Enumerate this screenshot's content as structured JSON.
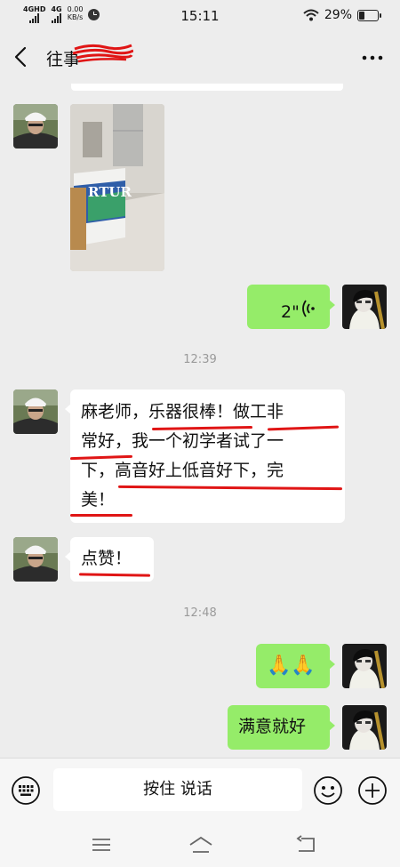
{
  "status_bar": {
    "net1": "4GHD",
    "net2": "4G",
    "speed": "0.00",
    "speed_unit": "KB/s",
    "time": "15:11",
    "battery": "29%",
    "battery_level": 0.29
  },
  "header": {
    "title": "往事",
    "back_icon": "chevron-left-icon",
    "more_icon": "more-dots-icon"
  },
  "messages": {
    "voice_duration": "2\"",
    "timestamp_1": "12:39",
    "msg_1": "麻老师，乐器很棒！做工非\n常好，我一个初学者试了一\n下，高音好上低音好下，完\n美！",
    "msg_2": "点赞！",
    "timestamp_2": "12:48",
    "msg_3": "🙏🙏",
    "msg_4": "满意就好",
    "photo_box_text": "RTUR"
  },
  "input_bar": {
    "voice_label": "按住 说话",
    "keyboard_icon": "keyboard-icon",
    "emoji_icon": "emoji-icon",
    "plus_icon": "plus-icon"
  },
  "nav_bar": {
    "menu_icon": "menu-icon",
    "home_icon": "home-icon",
    "back_icon": "back-icon"
  },
  "colors": {
    "background": "#ededed",
    "outgoing_bubble": "#95ec69",
    "incoming_bubble": "#ffffff",
    "annotation_red": "#e01515"
  }
}
